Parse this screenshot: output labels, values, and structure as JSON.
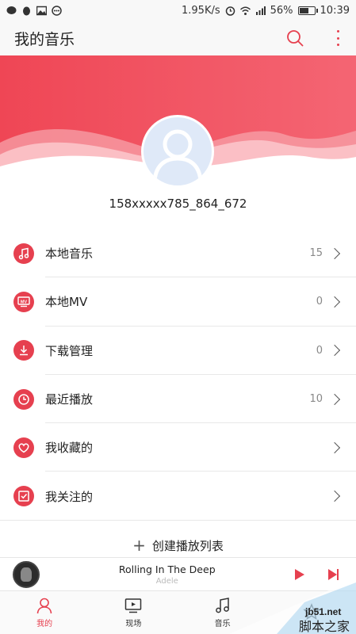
{
  "status_bar": {
    "speed": "1.95K/s",
    "battery": "56%",
    "battery_level": 0.56,
    "time": "10:39"
  },
  "header": {
    "title": "我的音乐",
    "search_icon": "search-icon",
    "more_icon": "more-vertical-icon"
  },
  "colors": {
    "accent": "#e6404f",
    "banner_start": "#ef4655",
    "banner_end": "#f46573"
  },
  "profile": {
    "username": "158xxxxx785_864_672"
  },
  "menu": [
    {
      "label": "本地音乐",
      "count": "15",
      "icon": "music-note-icon"
    },
    {
      "label": "本地MV",
      "count": "0",
      "icon": "mv-icon"
    },
    {
      "label": "下载管理",
      "count": "0",
      "icon": "download-icon"
    },
    {
      "label": "最近播放",
      "count": "10",
      "icon": "clock-icon"
    },
    {
      "label": "我收藏的",
      "count": "",
      "icon": "heart-icon"
    },
    {
      "label": "我关注的",
      "count": "",
      "icon": "check-box-icon"
    }
  ],
  "create_playlist": {
    "plus": "+",
    "label": "创建播放列表"
  },
  "player": {
    "song": "Rolling In The Deep",
    "artist": "Adele"
  },
  "tabs": [
    {
      "label": "我的",
      "icon": "user-icon",
      "active": true
    },
    {
      "label": "现场",
      "icon": "tv-icon",
      "active": false
    },
    {
      "label": "音乐",
      "icon": "music-note-icon",
      "active": false
    },
    {
      "label": "",
      "icon": "star-icon",
      "active": false
    }
  ],
  "watermark": {
    "site": "jb51.net",
    "text": "脚本之家"
  }
}
